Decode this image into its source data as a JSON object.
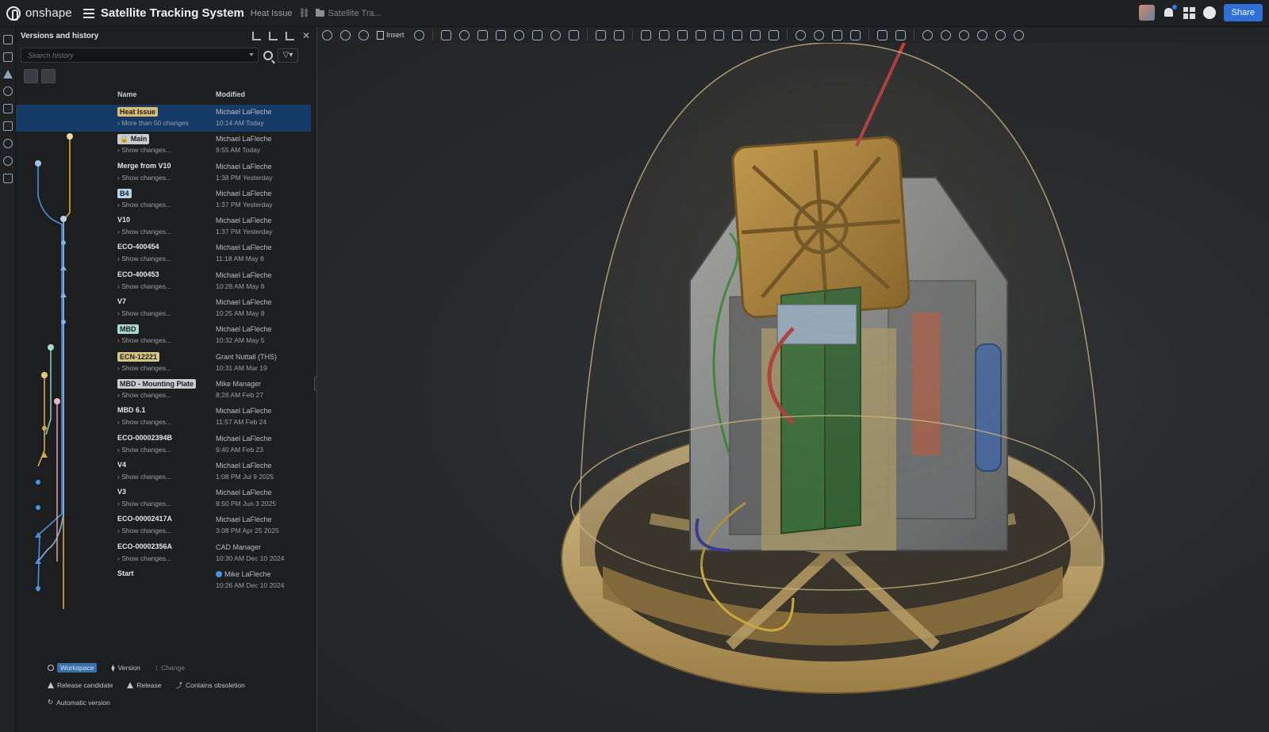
{
  "app": {
    "brand": "onshape",
    "document_title": "Satellite Tracking System",
    "workspace": "Heat Issue",
    "folder": "Satellite Tra..."
  },
  "topbar": {
    "share_label": "Share"
  },
  "panel": {
    "title": "Versions and history",
    "search_placeholder": "Search history",
    "columns": {
      "name": "Name",
      "modified": "Modified"
    },
    "rows": [
      {
        "name": "Heat Issue",
        "tag": "yellow",
        "sub": "› More than 50 changes",
        "user": "Michael LaFleche",
        "time": "10:14 AM Today",
        "selected": true
      },
      {
        "name": "🔒 Main",
        "tag": "gray",
        "sub": "› Show changes...",
        "user": "Michael LaFleche",
        "time": "9:55 AM Today"
      },
      {
        "name": "Merge from V10",
        "tag": "",
        "sub": "› Show changes...",
        "user": "Michael LaFleche",
        "time": "1:38 PM Yesterday"
      },
      {
        "name": "B4",
        "tag": "blue",
        "sub": "› Show changes...",
        "user": "Michael LaFleche",
        "time": "1:37 PM Yesterday"
      },
      {
        "name": "V10",
        "tag": "",
        "sub": "› Show changes...",
        "user": "Michael LaFleche",
        "time": "1:37 PM Yesterday"
      },
      {
        "name": "ECO-400454",
        "tag": "",
        "sub": "› Show changes...",
        "user": "Michael LaFleche",
        "time": "11:18 AM May 8"
      },
      {
        "name": "ECO-400453",
        "tag": "",
        "sub": "› Show changes...",
        "user": "Michael LaFleche",
        "time": "10:28 AM May 8"
      },
      {
        "name": "V7",
        "tag": "",
        "sub": "› Show changes...",
        "user": "Michael LaFleche",
        "time": "10:25 AM May 8"
      },
      {
        "name": "MBD",
        "tag": "teal",
        "sub": "› Show changes...",
        "user": "Michael LaFleche",
        "time": "10:32 AM May 5"
      },
      {
        "name": "ECN-12221",
        "tag": "outline",
        "sub": "› Show changes...",
        "user": "Grant Nuttall (THS)",
        "time": "10:31 AM Mar 19"
      },
      {
        "name": "MBD - Mounting Plate",
        "tag": "gray",
        "sub": "› Show changes...",
        "user": "Mike Manager",
        "time": "8:28 AM Feb 27"
      },
      {
        "name": "MBD 6.1",
        "tag": "",
        "sub": "› Show changes...",
        "user": "Michael LaFleche",
        "time": "11:57 AM Feb 24"
      },
      {
        "name": "ECO-00002394B",
        "tag": "",
        "sub": "› Show changes...",
        "user": "Michael LaFleche",
        "time": "9:40 AM Feb 23"
      },
      {
        "name": "V4",
        "tag": "",
        "sub": "› Show changes...",
        "user": "Michael LaFleche",
        "time": "1:08 PM Jul 9 2025"
      },
      {
        "name": "V3",
        "tag": "",
        "sub": "› Show changes...",
        "user": "Michael LaFleche",
        "time": "8:50 PM Jun 3 2025"
      },
      {
        "name": "ECO-00002417A",
        "tag": "",
        "sub": "› Show changes...",
        "user": "Michael LaFleche",
        "time": "3:08 PM Apr 25 2025"
      },
      {
        "name": "ECO-00002356A",
        "tag": "",
        "sub": "› Show changes...",
        "user": "CAD Manager",
        "time": "10:30 AM Dec 10 2024"
      },
      {
        "name": "Start",
        "tag": "",
        "sub": "",
        "user": "Mike LaFleche",
        "time": "10:26 AM Dec 10 2024"
      }
    ],
    "legend": {
      "workspace": "Workspace",
      "version": "Version",
      "change": "Change",
      "release_candidate": "Release candidate",
      "release": "Release",
      "contains_obsoletion": "Contains obsoletion",
      "automatic_version": "Automatic version"
    }
  },
  "toolbar": {
    "insert_label": "Insert"
  },
  "colors": {
    "accent": "#2f6fd8",
    "selected_row": "#163a66",
    "branch_blue": "#4d8fe0",
    "branch_yellow": "#d7a84a",
    "branch_teal": "#7fc9b8",
    "branch_pink": "#d99aa0"
  },
  "viewport": {
    "content": "3D model of satellite tracking assembly inside transparent dome"
  }
}
